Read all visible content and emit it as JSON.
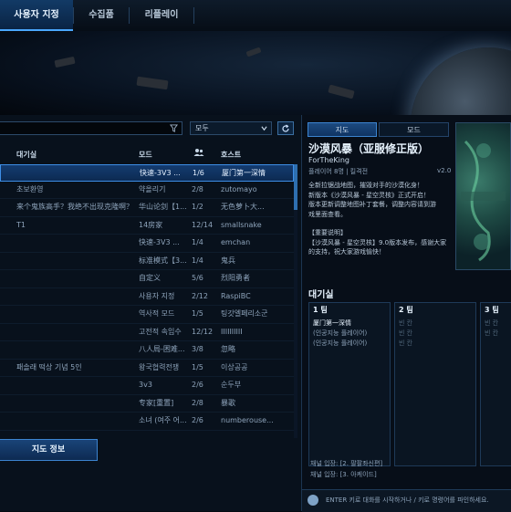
{
  "top_tabs": [
    {
      "label": "사용자 지정",
      "active": true
    },
    {
      "label": "수집품",
      "active": false
    },
    {
      "label": "리플레이",
      "active": false
    }
  ],
  "filter": {
    "search_value": "",
    "dropdown_value": "모두"
  },
  "columns": {
    "lobby": "대기실",
    "mode": "모드",
    "host": "호스트"
  },
  "lobbies": [
    {
      "name": "",
      "mode": "快速-3V3 ...",
      "players": "1/6",
      "host": "厦门第一深情",
      "selected": true
    },
    {
      "name": "초보환영",
      "mode": "약올리기",
      "players": "2/8",
      "host": "zutomayo"
    },
    {
      "name": "来个鬼族高手？我绝不出现克隆啊？",
      "mode": "华山论剑【1...",
      "players": "1/2",
      "host": "无色萝卜大..."
    },
    {
      "name": "T1",
      "mode": "14房家",
      "players": "12/14",
      "host": "smallsnake"
    },
    {
      "name": "",
      "mode": "快速-3V3 ...",
      "players": "1/4",
      "host": "emchan"
    },
    {
      "name": "",
      "mode": "标准模式【3...",
      "players": "1/4",
      "host": "鬼兵"
    },
    {
      "name": "",
      "mode": "自定义",
      "players": "5/6",
      "host": "烈阳勇者"
    },
    {
      "name": "",
      "mode": "사용자 지정",
      "players": "2/12",
      "host": "RaspiBC"
    },
    {
      "name": "",
      "mode": "역사적 모드",
      "players": "1/5",
      "host": "팅갓엘페리소군"
    },
    {
      "name": "",
      "mode": "고전적 속임수",
      "players": "12/12",
      "host": "IIIIIIIIII"
    },
    {
      "name": "",
      "mode": "八人局-困难...",
      "players": "3/8",
      "host": "忽略"
    },
    {
      "name": "패솔래 떡상 기념 5인",
      "mode": "왕국협력전쟁",
      "players": "1/5",
      "host": "이상공공"
    },
    {
      "name": "",
      "mode": "3v3",
      "players": "2/6",
      "host": "순두부"
    },
    {
      "name": "",
      "mode": "专家[重置]",
      "players": "2/8",
      "host": "暴歌"
    },
    {
      "name": "",
      "mode": "소녀 (여주 어...",
      "players": "2/6",
      "host": "numberouse..."
    }
  ],
  "map_info_button": "지도 정보",
  "right_tabs": [
    {
      "label": "지도",
      "active": true
    },
    {
      "label": "모드",
      "active": false
    }
  ],
  "map": {
    "name": "沙漠风暴（亚服修正版）",
    "author": "ForTheKing",
    "meta": "플레이어 8명 | 킬격전",
    "version": "v2.0",
    "description": [
      "全新拉锯战地图，摧毁对手的沙漠化身！",
      "新版本《沙漠风暴 - 星空灵核》正式开启！",
      "版本更新调整地图补丁套餐，调整内容请到游",
      "戏里面查看。",
      "",
      "【重要说明】",
      "【沙漠风暴 - 星空灵核】9.0版本发布，感谢大家",
      "的支持，祝大家游戏愉快！"
    ]
  },
  "lobby_title": "대기실",
  "teams": [
    {
      "name": "1 팀",
      "slots": [
        "厦门第一深情",
        "(인공지능 플레이어)",
        "(인공지능 플레이어)"
      ]
    },
    {
      "name": "2 팀",
      "slots": [
        "빈 칸",
        "빈 칸",
        "빈 칸"
      ]
    },
    {
      "name": "3 팀",
      "slots": [
        "빈 칸",
        "빈 칸"
      ]
    }
  ],
  "chat_log": [
    "채널 입장: [2. 팔팔좌신편]",
    "채널 입장: [3. 아케이드]"
  ],
  "chat_hint": "ENTER 키로 대화를 시작하거나 / 키로 명령어를 파인하세요.",
  "colors": {
    "accent": "#3d8ee6",
    "selected_row": "#143c70",
    "background": "#050a12"
  }
}
